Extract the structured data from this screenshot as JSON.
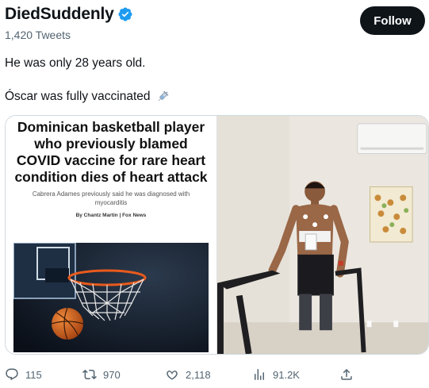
{
  "profile": {
    "name": "DiedSuddenly",
    "tweet_count": "1,420 Tweets",
    "follow_label": "Follow",
    "verified_icon": "verified-badge-icon"
  },
  "tweet": {
    "line1": "He was only 28 years old.",
    "line2": "Óscar was fully vaccinated",
    "line2_icon": "syringe-icon"
  },
  "article": {
    "headline": "Dominican basketball player who previously blamed COVID vaccine for rare heart condition dies of heart attack",
    "subheadline": "Cabrera Adames previously said he was diagnosed with myocarditis",
    "byline": "By Chantz Martin | Fox News"
  },
  "actions": {
    "replies": "115",
    "retweets": "970",
    "likes": "2,118",
    "views": "91.2K"
  },
  "colors": {
    "accent": "#1d9bf0",
    "text": "#0f1419",
    "muted": "#536471",
    "follow_bg": "#0f1419"
  }
}
